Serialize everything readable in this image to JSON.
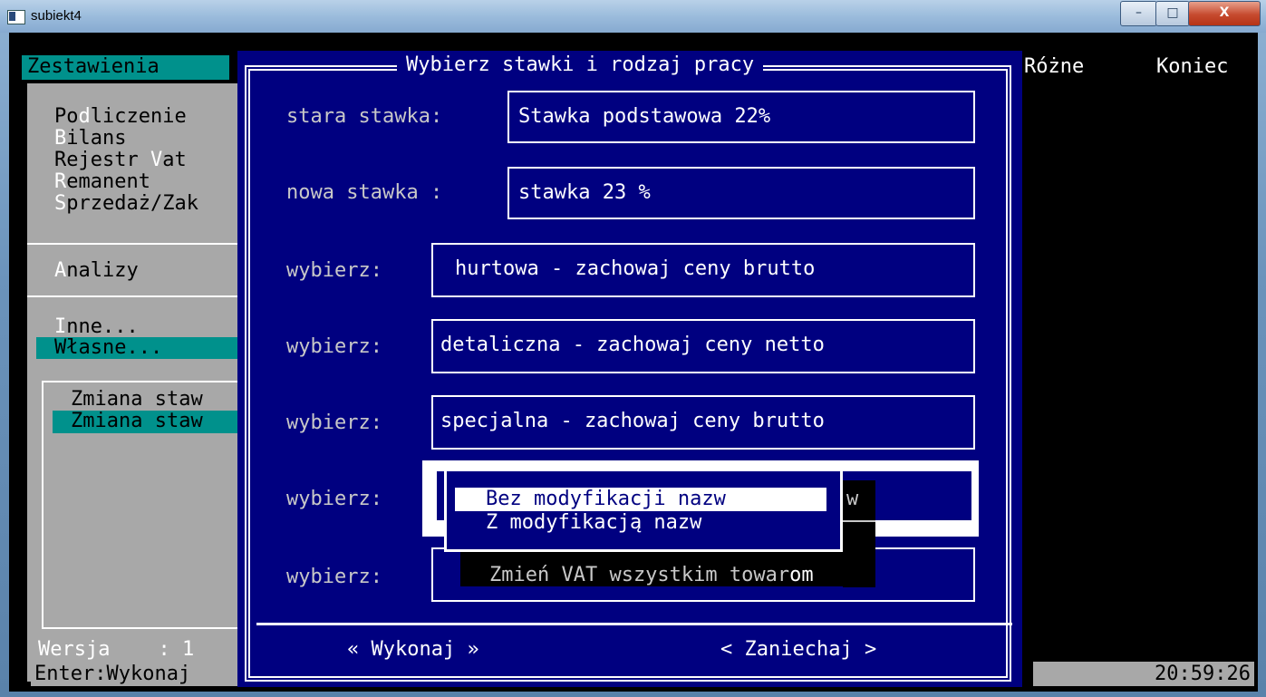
{
  "window": {
    "title": "subiekt4",
    "minimize": "–",
    "maximize": "□",
    "close": "X"
  },
  "menubar": {
    "zestawienia": "Zestawienia",
    "rozne": "Różne",
    "koniec": "Koniec"
  },
  "left_menu": {
    "items": [
      {
        "hot": "",
        "pre": "Po",
        "key": "d",
        "rest": "liczenie"
      },
      {
        "pre": "",
        "key": "B",
        "rest": "ilans"
      },
      {
        "pre": "Rejestr ",
        "key": "V",
        "rest": "at"
      },
      {
        "pre": "",
        "key": "R",
        "rest": "emanent"
      },
      {
        "pre": "",
        "key": "S",
        "rest": "przedaż/Zak"
      }
    ],
    "analizy_key": "A",
    "analizy_rest": "nalizy",
    "inne_key": "I",
    "inne_rest": "nne...",
    "wlasne": "Własne...",
    "submenu_1": "Zmiana staw",
    "submenu_2": "Zmiana staw",
    "wersja": "Wersja    : 1",
    "enter": "Enter:Wykonaj"
  },
  "dialog": {
    "title": "Wybierz stawki i rodzaj pracy",
    "old_rate_label": "stara stawka:",
    "old_rate_value": "Stawka podstawowa 22%",
    "new_rate_label": "nowa stawka :",
    "new_rate_value": "stawka 23 %",
    "choose_label": "wybierz:",
    "price_hurtowa": "hurtowa - zachowaj ceny brutto",
    "price_detaliczna": "detaliczna - zachowaj ceny netto",
    "price_specjalna": "specjalna - zachowaj ceny brutto",
    "hidden_fragment": "w",
    "popup_options": [
      "Bez modyfikacji nazw",
      "Z modyfikacją nazw"
    ],
    "zmien_pre": "Zmień VAT wszystkim towar",
    "zmien_post": "om",
    "execute": "« Wykonaj »",
    "cancel": "< Zaniechaj >"
  },
  "status": {
    "time": "20:59:26"
  }
}
